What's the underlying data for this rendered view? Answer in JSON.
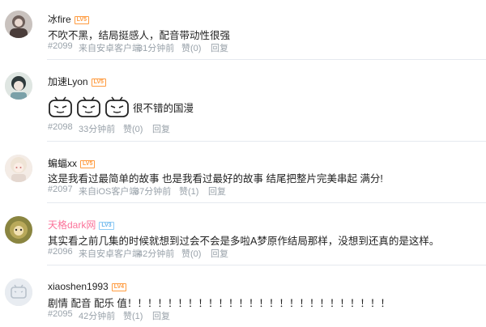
{
  "comments": [
    {
      "user": "冰fire",
      "level": "LV5",
      "text": "不吹不黑，结局挺感人，配音带动性很强",
      "floor": "#2099",
      "source": "来自安卓客户端",
      "time": "31分钟前",
      "like": "赞(0)",
      "reply": "回复"
    },
    {
      "user": "加速Lyon",
      "level": "LV5",
      "text": "很不错的国漫",
      "emote_icon": "tv-face-emoji-icon",
      "floor": "#2098",
      "source": "",
      "time": "33分钟前",
      "like": "赞(0)",
      "reply": "回复"
    },
    {
      "user": "蝙蝠xx",
      "level": "LV5",
      "text": "这是我看过最简单的故事 也是我看过最好的故事 结尾把整片完美串起 满分!",
      "floor": "#2097",
      "source": "来自iOS客户端",
      "time": "37分钟前",
      "like": "赞(1)",
      "reply": "回复"
    },
    {
      "user": "天格dark网",
      "level": "LV3",
      "text": "其实看之前几集的时候就想到过会不会是多啦A梦原作结局那样，没想到还真的是这样。",
      "floor": "#2096",
      "source": "来自安卓客户端",
      "time": "42分钟前",
      "like": "赞(0)",
      "reply": "回复"
    },
    {
      "user": "xiaoshen1993",
      "level": "LV4",
      "text": "剧情 配音 配乐 值！！！！！！！！！！！！！！！！！！！！！！！！！！",
      "floor": "#2095",
      "source": "",
      "time": "42分钟前",
      "like": "赞(1)",
      "reply": "回复"
    }
  ],
  "colors": {
    "meta": "#99a2aa",
    "vip_name": "#fb7299",
    "level_badge": "#ff9b3f",
    "divider": "#e5e9ef"
  }
}
